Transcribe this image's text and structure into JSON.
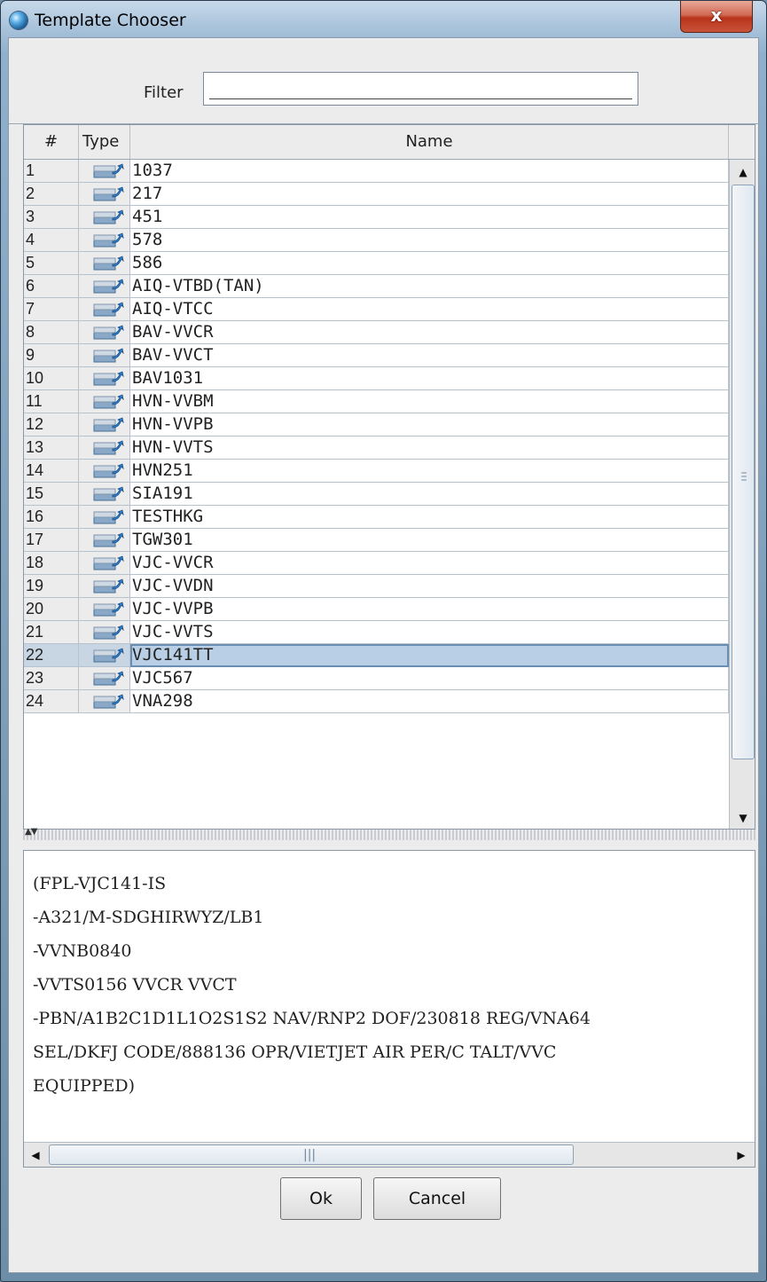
{
  "window": {
    "title": "Template Chooser",
    "close_label": "x"
  },
  "filter": {
    "label": "Filter",
    "value": ""
  },
  "table": {
    "columns": [
      "#",
      "Type",
      "Name"
    ],
    "selected_index": 22,
    "rows": [
      {
        "num": "1",
        "name": "1037"
      },
      {
        "num": "2",
        "name": "217"
      },
      {
        "num": "3",
        "name": "451"
      },
      {
        "num": "4",
        "name": "578"
      },
      {
        "num": "5",
        "name": "586"
      },
      {
        "num": "6",
        "name": "AIQ-VTBD(TAN)"
      },
      {
        "num": "7",
        "name": "AIQ-VTCC"
      },
      {
        "num": "8",
        "name": "BAV-VVCR"
      },
      {
        "num": "9",
        "name": "BAV-VVCT"
      },
      {
        "num": "10",
        "name": "BAV1031"
      },
      {
        "num": "11",
        "name": "HVN-VVBM"
      },
      {
        "num": "12",
        "name": "HVN-VVPB"
      },
      {
        "num": "13",
        "name": "HVN-VVTS"
      },
      {
        "num": "14",
        "name": "HVN251"
      },
      {
        "num": "15",
        "name": "SIA191"
      },
      {
        "num": "16",
        "name": "TESTHKG"
      },
      {
        "num": "17",
        "name": "TGW301"
      },
      {
        "num": "18",
        "name": "VJC-VVCR"
      },
      {
        "num": "19",
        "name": "VJC-VVDN"
      },
      {
        "num": "20",
        "name": "VJC-VVPB"
      },
      {
        "num": "21",
        "name": "VJC-VVTS"
      },
      {
        "num": "22",
        "name": "VJC141TT"
      },
      {
        "num": "23",
        "name": "VJC567"
      },
      {
        "num": "24",
        "name": "VNA298"
      }
    ]
  },
  "preview": {
    "lines": [
      "(FPL-VJC141-IS",
      "-A321/M-SDGHIRWYZ/LB1",
      "-VVNB0840",
      "-VVTS0156 VVCR VVCT",
      "-PBN/A1B2C1D1L1O2S1S2 NAV/RNP2 DOF/230818 REG/VNA64",
      "SEL/DKFJ CODE/888136 OPR/VIETJET AIR PER/C TALT/VVC",
      "EQUIPPED)"
    ]
  },
  "buttons": {
    "ok": "Ok",
    "cancel": "Cancel"
  },
  "icons": {
    "app": "globe-icon",
    "row_type": "template-arrow-icon"
  },
  "colors": {
    "selection": "#b8cfe5",
    "close": "#c9533a"
  }
}
